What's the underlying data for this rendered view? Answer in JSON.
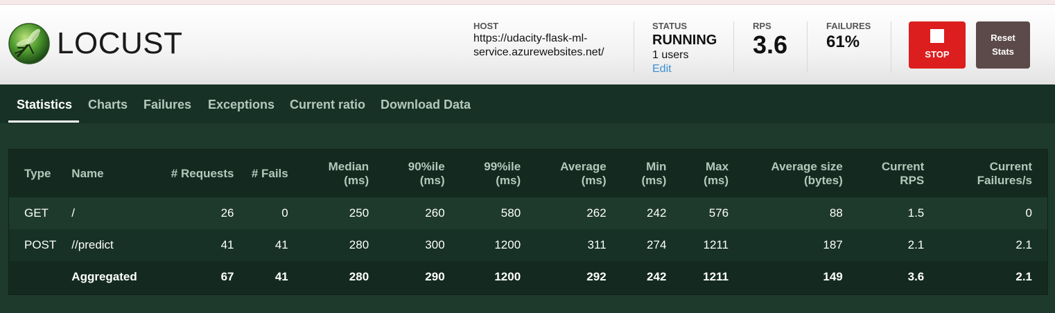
{
  "app": {
    "name": "LOCUST"
  },
  "host": {
    "label": "HOST",
    "line1": "https://udacity-flask-ml-",
    "line2": "service.azurewebsites.net/"
  },
  "status": {
    "label": "STATUS",
    "state": "RUNNING",
    "users": "1 users",
    "edit": "Edit"
  },
  "rps": {
    "label": "RPS",
    "value": "3.6"
  },
  "failures": {
    "label": "FAILURES",
    "value": "61%"
  },
  "buttons": {
    "stop": "STOP",
    "reset_line1": "Reset",
    "reset_line2": "Stats"
  },
  "tabs": [
    "Statistics",
    "Charts",
    "Failures",
    "Exceptions",
    "Current ratio",
    "Download Data"
  ],
  "table": {
    "headers": [
      [
        "Type"
      ],
      [
        "Name"
      ],
      [
        "# Requests"
      ],
      [
        "# Fails"
      ],
      [
        "Median",
        "(ms)"
      ],
      [
        "90%ile",
        "(ms)"
      ],
      [
        "99%ile",
        "(ms)"
      ],
      [
        "Average",
        "(ms)"
      ],
      [
        "Min",
        "(ms)"
      ],
      [
        "Max",
        "(ms)"
      ],
      [
        "Average size",
        "(bytes)"
      ],
      [
        "Current",
        "RPS"
      ],
      [
        "Current",
        "Failures/s"
      ]
    ],
    "rows": [
      [
        "GET",
        "/",
        "26",
        "0",
        "250",
        "260",
        "580",
        "262",
        "242",
        "576",
        "88",
        "1.5",
        "0"
      ],
      [
        "POST",
        "//predict",
        "41",
        "41",
        "280",
        "300",
        "1200",
        "311",
        "274",
        "1211",
        "187",
        "2.1",
        "2.1"
      ]
    ],
    "aggregated": [
      "",
      "Aggregated",
      "67",
      "41",
      "280",
      "290",
      "1200",
      "292",
      "242",
      "1211",
      "149",
      "3.6",
      "2.1"
    ]
  },
  "colors": {
    "accent_green": "#1e3a2c",
    "stop_red": "#dd1e1e",
    "reset_brown": "#5b4a49",
    "link_blue": "#3d8fd6"
  }
}
